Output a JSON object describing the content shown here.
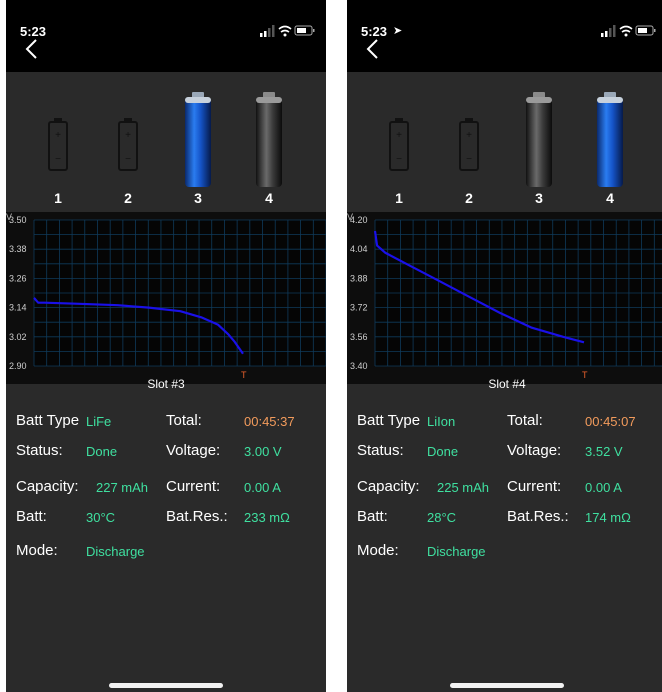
{
  "screens": [
    {
      "status_time": "5:23",
      "location_arrow": false,
      "battery_icons": [
        {
          "number": "1",
          "state": "empty"
        },
        {
          "number": "2",
          "state": "empty"
        },
        {
          "number": "3",
          "state": "blue"
        },
        {
          "number": "4",
          "state": "grey"
        }
      ],
      "chart_data": {
        "type": "line",
        "ylabel": "V",
        "y_ticks": [
          "3.50",
          "3.38",
          "3.26",
          "3.14",
          "3.02",
          "2.90"
        ],
        "ylim": [
          2.9,
          3.5
        ],
        "xlabel": "T",
        "grid": true,
        "series_color": "#1a10e8",
        "series": [
          {
            "x": [
              0,
              0.02,
              0.05,
              0.2,
              0.4,
              0.55,
              0.7,
              0.8,
              0.88,
              0.93,
              0.96,
              1.0
            ],
            "values": [
              3.18,
              3.16,
              3.16,
              3.156,
              3.15,
              3.14,
              3.125,
              3.1,
              3.07,
              3.03,
              3.0,
              2.95
            ]
          }
        ]
      },
      "slot": "Slot #3",
      "rows": [
        {
          "l1": "Batt Type",
          "v1": "LiFe",
          "l2": "Total:",
          "v2": "00:45:37",
          "v2_orange": true
        },
        {
          "l1": "Status:",
          "v1": "Done",
          "l2": "Voltage:",
          "v2": "3.00 V"
        },
        {
          "l1": "Capacity:",
          "v1": "227 mAh",
          "l2": "Current:",
          "v2": "0.00 A"
        },
        {
          "l1": "Batt:",
          "v1": "30°C",
          "l2": "Bat.Res.:",
          "v2": "233 mΩ"
        },
        {
          "l1": "Mode:",
          "v1": "Discharge"
        }
      ]
    },
    {
      "status_time": "5:23",
      "location_arrow": true,
      "battery_icons": [
        {
          "number": "1",
          "state": "empty"
        },
        {
          "number": "2",
          "state": "empty"
        },
        {
          "number": "3",
          "state": "grey"
        },
        {
          "number": "4",
          "state": "blue"
        }
      ],
      "chart_data": {
        "type": "line",
        "ylabel": "V",
        "y_ticks": [
          "4.20",
          "4.04",
          "3.88",
          "3.72",
          "3.56",
          "3.40"
        ],
        "ylim": [
          3.4,
          4.2
        ],
        "xlabel": "T",
        "grid": true,
        "series_color": "#1a10e8",
        "series": [
          {
            "x": [
              0,
              0.01,
              0.05,
              0.15,
              0.3,
              0.45,
              0.6,
              0.75,
              0.9,
              1.0
            ],
            "values": [
              4.14,
              4.06,
              4.02,
              3.96,
              3.87,
              3.78,
              3.69,
              3.61,
              3.56,
              3.53
            ]
          }
        ]
      },
      "slot": "Slot #4",
      "rows": [
        {
          "l1": "Batt Type",
          "v1": "LiIon",
          "l2": "Total:",
          "v2": "00:45:07",
          "v2_orange": true
        },
        {
          "l1": "Status:",
          "v1": "Done",
          "l2": "Voltage:",
          "v2": "3.52 V"
        },
        {
          "l1": "Capacity:",
          "v1": "225 mAh",
          "l2": "Current:",
          "v2": "0.00 A"
        },
        {
          "l1": "Batt:",
          "v1": "28°C",
          "l2": "Bat.Res.:",
          "v2": "174 mΩ"
        },
        {
          "l1": "Mode:",
          "v1": "Discharge"
        }
      ]
    }
  ]
}
